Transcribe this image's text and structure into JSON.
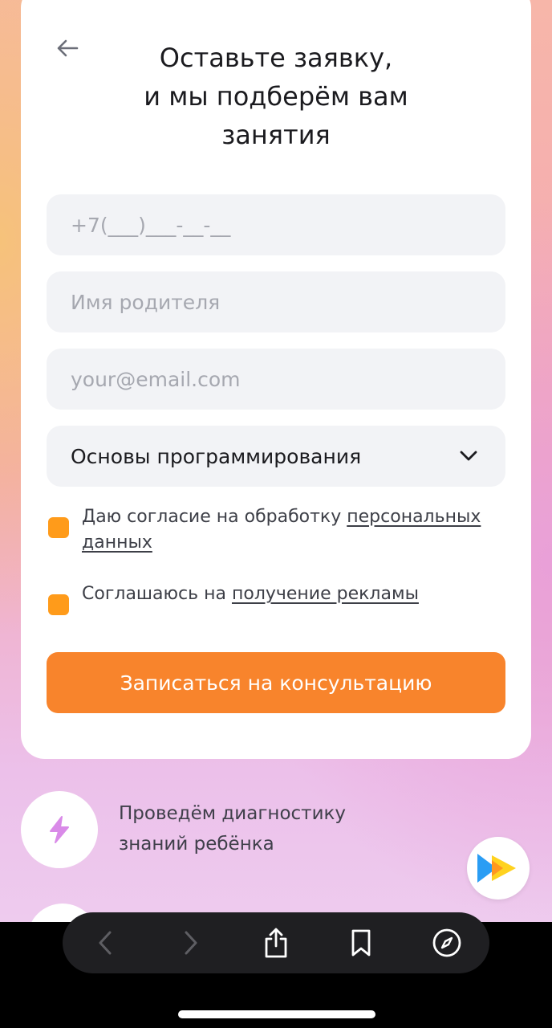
{
  "form": {
    "title_lines": [
      "Оставьте заявку,",
      "и мы подберём вам",
      "занятия"
    ],
    "phone_placeholder": "+7(___)___-__-__",
    "name_placeholder": "Имя родителя",
    "email_placeholder": "your@email.com",
    "course_selected": "Основы программирования",
    "consent_personal": {
      "text": "Даю согласие на обработку ",
      "link": "персональных данных",
      "checked": true
    },
    "consent_ads": {
      "text": "Соглашаюсь на ",
      "link": "получение рекламы",
      "checked": true
    },
    "submit_label": "Записаться на консультацию"
  },
  "feature": {
    "line1": "Проведём диагностику",
    "line2": "знаний ребёнка",
    "icon": "lightning-icon"
  },
  "browser_toolbar": {
    "items": [
      "back-icon",
      "forward-icon",
      "share-icon",
      "bookmarks-icon",
      "compass-icon"
    ]
  },
  "colors": {
    "accent": "#f8842c",
    "checkbox": "#ff9b1a",
    "field_bg": "#f2f3f6"
  }
}
